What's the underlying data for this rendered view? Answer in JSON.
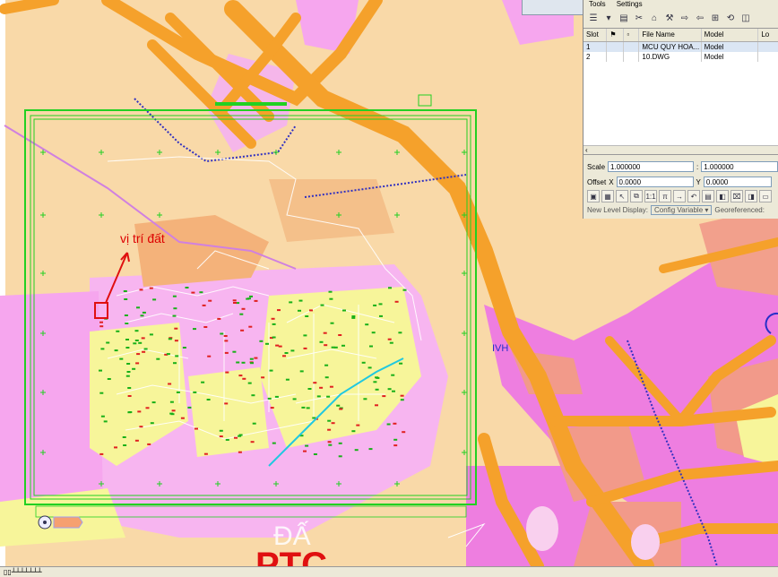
{
  "annotation": {
    "label": "vị trí đất"
  },
  "map": {
    "zone_label": "IVH"
  },
  "reference_panel": {
    "menu": [
      "Tools",
      "Settings"
    ],
    "columns": [
      "Slot",
      "",
      "",
      "File Name",
      "Model",
      "Lo"
    ],
    "rows": [
      {
        "slot": "1",
        "file": "MCU QUY HOA...",
        "model": "Model",
        "selected": true
      },
      {
        "slot": "2",
        "file": "10.DWG",
        "model": "Model",
        "selected": false
      }
    ],
    "scale_label": "Scale",
    "scale_value_1": "1.000000",
    "scale_sep": ":",
    "scale_value_2": "1.000000",
    "offset_label": "Offset",
    "x_label": "X",
    "x_value": "0.0000",
    "y_label": "Y",
    "y_value": "0.0000",
    "new_level_label": "New Level Display:",
    "new_level_value": "Config Variable",
    "georef_label": "Georeferenced:"
  },
  "colors": {
    "background": "#f9d9a8",
    "pink_zone": "#f6a6ee",
    "magenta_zone": "#ee7ee0",
    "yellow_zone": "#f7f59a",
    "orange_road": "#f5a12b",
    "salmon_zone": "#f29a8a",
    "green_frame": "#22d022",
    "annotation_red": "#e01010"
  }
}
